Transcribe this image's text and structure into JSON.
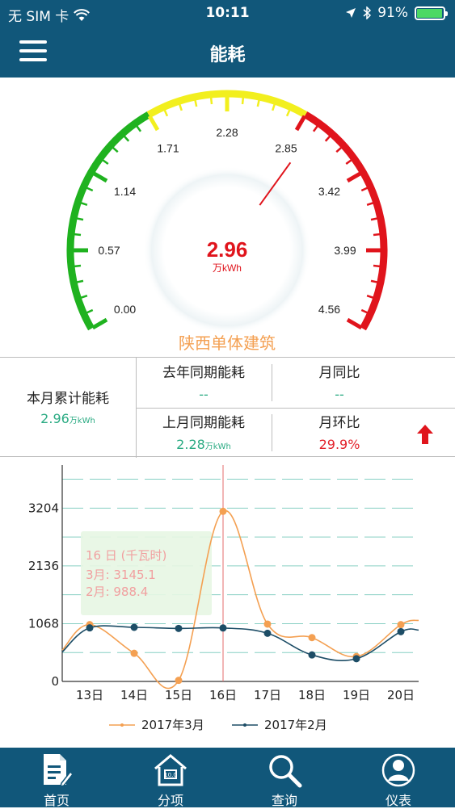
{
  "status_bar": {
    "carrier": "无 SIM 卡",
    "time": "10:11",
    "battery": "91%"
  },
  "nav": {
    "title": "能耗"
  },
  "gauge": {
    "value": "2.96",
    "value_number": 2.96,
    "unit": "万kWh",
    "building": "陕西单体建筑",
    "min": 0,
    "max": 4.56,
    "tick_labels": [
      "0.00",
      "0.57",
      "1.14",
      "1.71",
      "2.28",
      "2.85",
      "3.42",
      "3.99",
      "4.56"
    ],
    "color_bands": {
      "green": "#1fb21f",
      "yellow": "#f2ef1e",
      "red": "#e0141c"
    }
  },
  "stats": {
    "monthly_total_label": "本月累计能耗",
    "monthly_total_value": "2.96",
    "monthly_total_unit": "万kWh",
    "last_year_label": "去年同期能耗",
    "last_year_value": "--",
    "yoy_label": "月同比",
    "yoy_value": "--",
    "last_month_label": "上月同期能耗",
    "last_month_value": "2.28",
    "last_month_unit": "万kWh",
    "mom_label": "月环比",
    "mom_value": "29.9%",
    "trend_icon": "arrow-up-icon"
  },
  "chart_data": {
    "type": "line",
    "categories": [
      "13日",
      "14日",
      "15日",
      "16日",
      "17日",
      "18日",
      "19日",
      "20日"
    ],
    "y_ticks": [
      "3204",
      "2136",
      "1068",
      "0"
    ],
    "ylim": [
      0,
      4000
    ],
    "series": [
      {
        "name": "2017年3月",
        "color": "#f4a052",
        "values": [
          1050,
          520,
          20,
          3145.1,
          1060,
          810,
          460,
          1050
        ]
      },
      {
        "name": "2017年2月",
        "color": "#1d4d66",
        "values": [
          990,
          1000,
          980,
          988.4,
          890,
          490,
          420,
          920
        ]
      }
    ],
    "highlight_category": "16日",
    "tooltip": {
      "title": "16 日  (千瓦时)",
      "line1": "3月: 3145.1",
      "line2": "2月: 988.4"
    }
  },
  "tabs": [
    {
      "label": "首页",
      "icon": "document-edit-icon"
    },
    {
      "label": "分项",
      "icon": "house-meter-icon"
    },
    {
      "label": "查询",
      "icon": "search-icon"
    },
    {
      "label": "仪表",
      "icon": "user-icon"
    }
  ]
}
